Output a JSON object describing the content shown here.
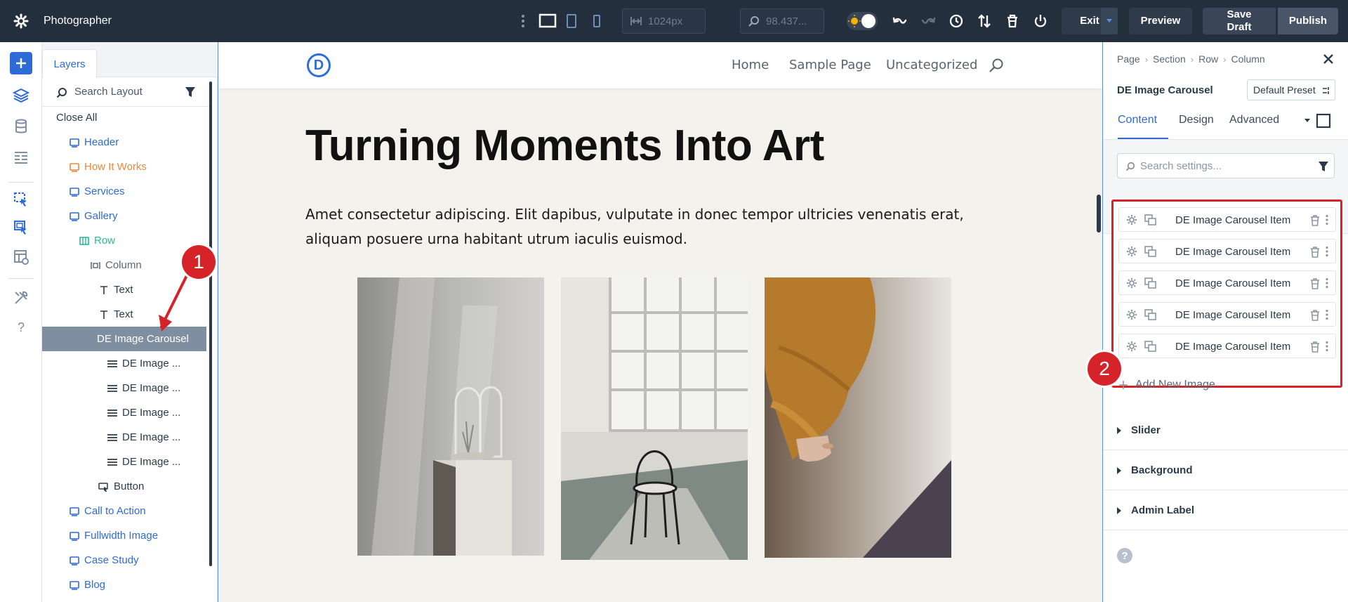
{
  "app": {
    "title": "Photographer",
    "width_field": "1024px",
    "zoom_field": "98.437...",
    "buttons": {
      "exit": "Exit",
      "preview": "Preview",
      "save_draft": "Save Draft",
      "publish": "Publish"
    }
  },
  "layers": {
    "tab": "Layers",
    "search_placeholder": "Search Layout",
    "close_all": "Close All",
    "items": [
      {
        "label": "Header",
        "kind": "section",
        "color": "#2e6bd6"
      },
      {
        "label": "How It Works",
        "kind": "section",
        "color": "#e8893a"
      },
      {
        "label": "Services",
        "kind": "section",
        "color": "#2e6bd6"
      },
      {
        "label": "Gallery",
        "kind": "section",
        "color": "#2e6bd6"
      },
      {
        "label": "Row",
        "kind": "row",
        "color": "#29b990"
      },
      {
        "label": "Column",
        "kind": "column",
        "color": "#5a6778"
      },
      {
        "label": "Text",
        "kind": "text",
        "color": "#2b3a4a"
      },
      {
        "label": "Text",
        "kind": "text",
        "color": "#2b3a4a"
      },
      {
        "label": "DE Image Carousel",
        "kind": "module",
        "color": "#ffffff",
        "selected": true
      },
      {
        "label": "DE Image ...",
        "kind": "item",
        "color": "#2b3a4a"
      },
      {
        "label": "DE Image ...",
        "kind": "item",
        "color": "#2b3a4a"
      },
      {
        "label": "DE Image ...",
        "kind": "item",
        "color": "#2b3a4a"
      },
      {
        "label": "DE Image ...",
        "kind": "item",
        "color": "#2b3a4a"
      },
      {
        "label": "DE Image ...",
        "kind": "item",
        "color": "#2b3a4a"
      },
      {
        "label": "Button",
        "kind": "button",
        "color": "#2b3a4a"
      },
      {
        "label": "Call to Action",
        "kind": "section",
        "color": "#2e6bd6"
      },
      {
        "label": "Fullwidth Image",
        "kind": "section",
        "color": "#2e6bd6"
      },
      {
        "label": "Case Study",
        "kind": "section",
        "color": "#2e6bd6"
      },
      {
        "label": "Blog",
        "kind": "section",
        "color": "#2e6bd6"
      }
    ]
  },
  "site": {
    "logo": "D",
    "nav": [
      "Home",
      "Sample Page",
      "Uncategorized"
    ],
    "hero_title": "Turning Moments Into Art",
    "hero_text": "Amet consectetur adipiscing. Elit dapibus, vulputate in donec tempor ultricies venenatis erat, aliquam posuere urna habitant utrum iaculis euismod."
  },
  "settings": {
    "breadcrumb": [
      "Page",
      "Section",
      "Row",
      "Column"
    ],
    "module_title": "DE Image Carousel",
    "preset": "Default Preset",
    "tabs": [
      "Content",
      "Design",
      "Advanced"
    ],
    "search_placeholder": "Search settings...",
    "items": [
      "DE Image Carousel Item",
      "DE Image Carousel Item",
      "DE Image Carousel Item",
      "DE Image Carousel Item",
      "DE Image Carousel Item"
    ],
    "add_new": "Add New Image",
    "toggles": [
      "Slider",
      "Background",
      "Admin Label"
    ],
    "help": "?"
  },
  "annotations": [
    "1",
    "2"
  ],
  "colors": {
    "accent": "#2e6bd6",
    "topbar": "#242f3e",
    "annotation": "#d6232a",
    "selected_layer": "#7f8ea1"
  }
}
